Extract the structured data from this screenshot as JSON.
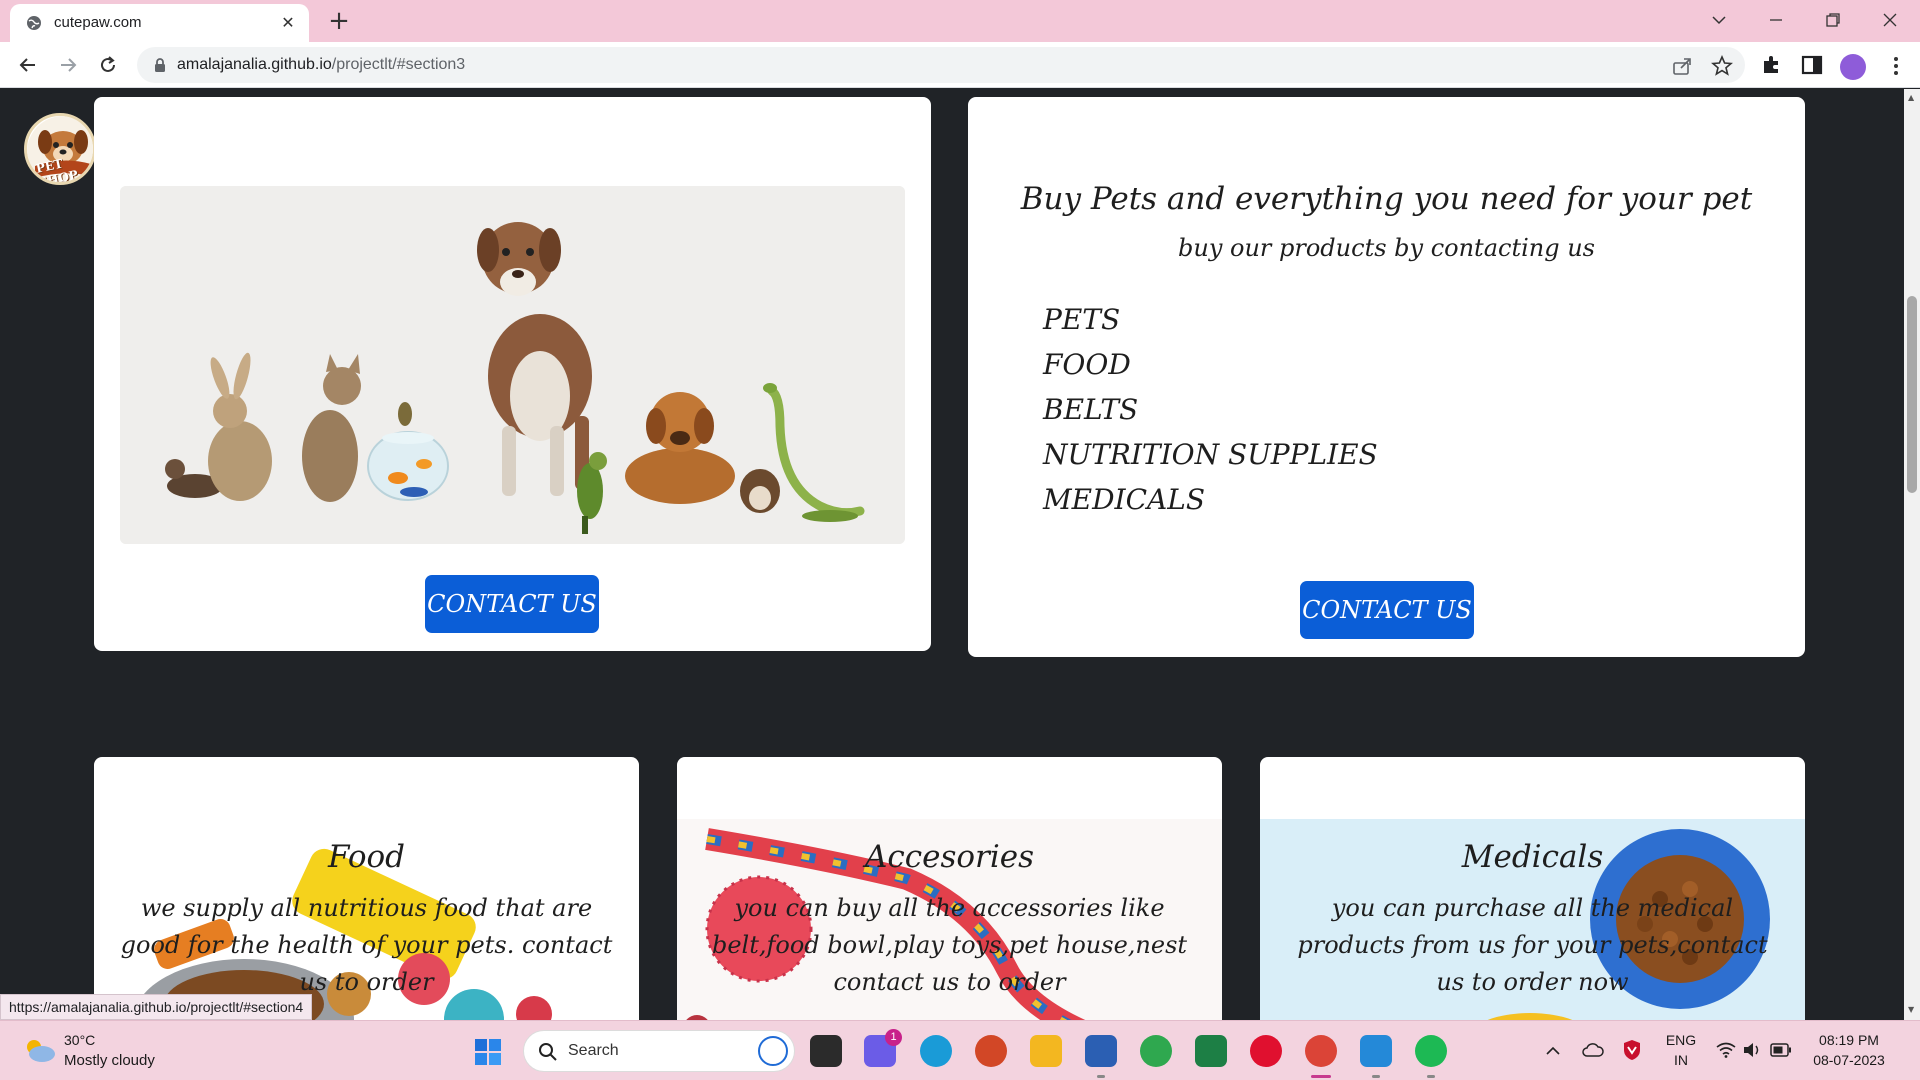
{
  "browser": {
    "tab_title": "cutepaw.com",
    "url_host": "amalajanalia.github.io",
    "url_path": "/projectlt/#section3",
    "status_url": "https://amalajanalia.github.io/projectlt/#section4"
  },
  "logo": {
    "text": "PET SHOP"
  },
  "hero_card": {
    "button_label": "CONTACT US"
  },
  "info_card": {
    "title": "Buy Pets and everything you need for your pet",
    "subtitle": "buy our products by contacting us",
    "items": [
      "PETS",
      "FOOD",
      "BELTS",
      "NUTRITION SUPPLIES",
      "MEDICALS"
    ],
    "button_label": "CONTACT US"
  },
  "product_cards": [
    {
      "title": "Food",
      "text": "we supply all nutritious food that are good for the health of your pets. contact us to order"
    },
    {
      "title": "Accesories",
      "text": "you can buy all the accessories like belt,food bowl,play toys,pet house,nest contact us to order"
    },
    {
      "title": "Medicals",
      "text": "you can purchase all the medical products from us for your pets,contact us to order now"
    }
  ],
  "taskbar": {
    "weather_temp": "30°C",
    "weather_desc": "Mostly cloudy",
    "search_label": "Search",
    "chat_badge": "1",
    "lang_top": "ENG",
    "lang_bottom": "IN",
    "time": "08:19 PM",
    "date": "08-07-2023"
  },
  "colors": {
    "page_bg": "#202327",
    "button": "#0b5ed7",
    "tab_strip": "#f3c8d8",
    "taskbar": "#f3d3df"
  }
}
